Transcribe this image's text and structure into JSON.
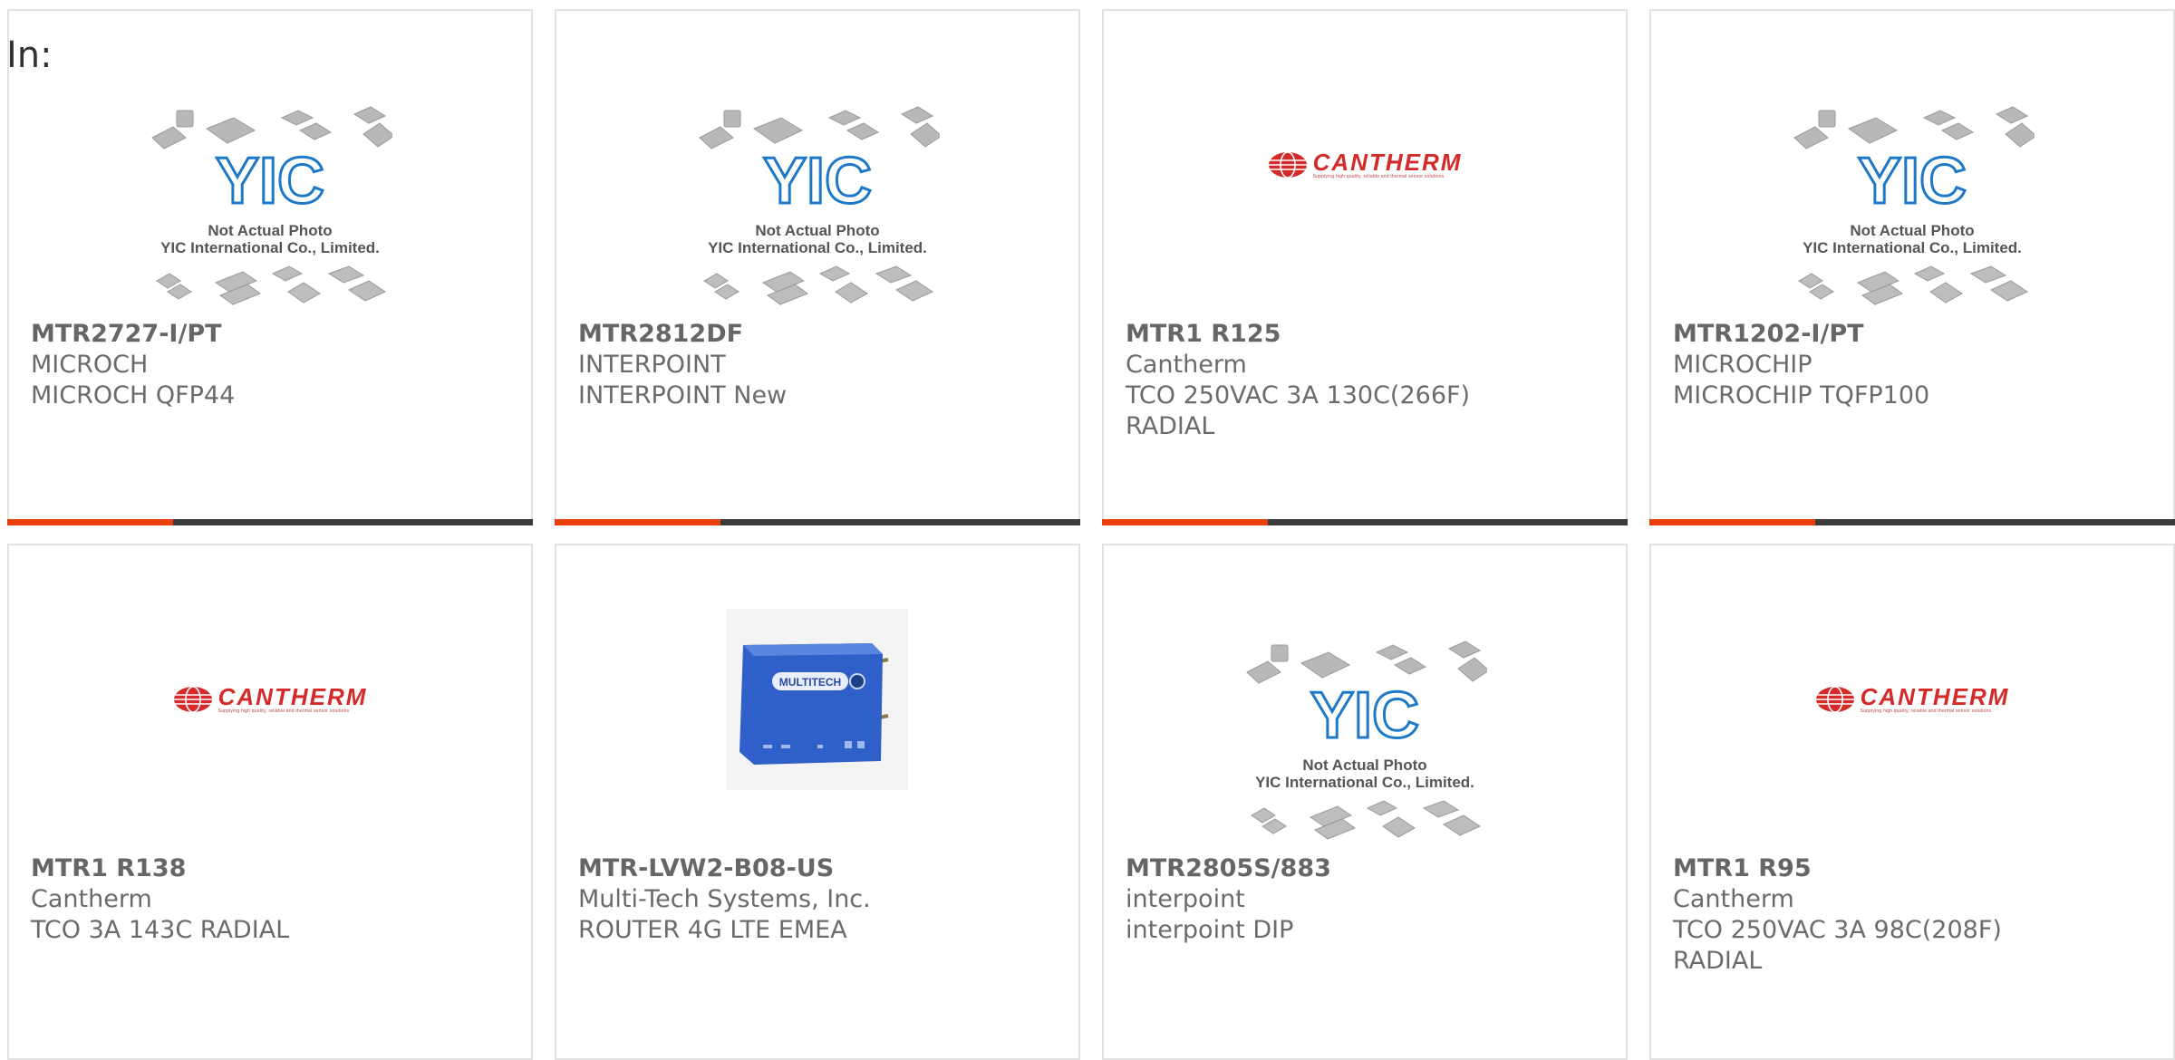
{
  "filter": {
    "label": "In:"
  },
  "placeholder": {
    "logo": "YIC",
    "line1": "Not Actual Photo",
    "line2": "YIC International Co., Limited."
  },
  "cantherm_logo": {
    "word": "CANTHERM",
    "tagline": "Supplying high quality, reliable and thermal sensor solutions"
  },
  "router_brand": "MULTITECH",
  "colors": {
    "accent": "#e8400c",
    "bar": "#3b3b3b",
    "border": "#e2e2e2",
    "text": "#6b6b6b"
  },
  "products": [
    {
      "part": "MTR2727-I/PT",
      "manufacturer": "MICROCH",
      "description": "MICROCH QFP44",
      "image": "yic-placeholder"
    },
    {
      "part": "MTR2812DF",
      "manufacturer": "INTERPOINT",
      "description": "INTERPOINT New",
      "image": "yic-placeholder"
    },
    {
      "part": "MTR1 R125",
      "manufacturer": "Cantherm",
      "description": "TCO 250VAC 3A 130C(266F)",
      "description2": "RADIAL",
      "image": "cantherm-logo"
    },
    {
      "part": "MTR1202-I/PT",
      "manufacturer": "MICROCHIP",
      "description": "MICROCHIP TQFP100",
      "image": "yic-placeholder"
    },
    {
      "part": "MTR1 R138",
      "manufacturer": "Cantherm",
      "description": "TCO 3A 143C RADIAL",
      "image": "cantherm-logo"
    },
    {
      "part": "MTR-LVW2-B08-US",
      "manufacturer": "Multi-Tech Systems, Inc.",
      "description": "ROUTER 4G LTE EMEA",
      "image": "router-photo"
    },
    {
      "part": "MTR2805S/883",
      "manufacturer": "interpoint",
      "description": "interpoint DIP",
      "image": "yic-placeholder"
    },
    {
      "part": "MTR1 R95",
      "manufacturer": "Cantherm",
      "description": "TCO 250VAC 3A 98C(208F)",
      "description2": "RADIAL",
      "image": "cantherm-logo"
    }
  ]
}
